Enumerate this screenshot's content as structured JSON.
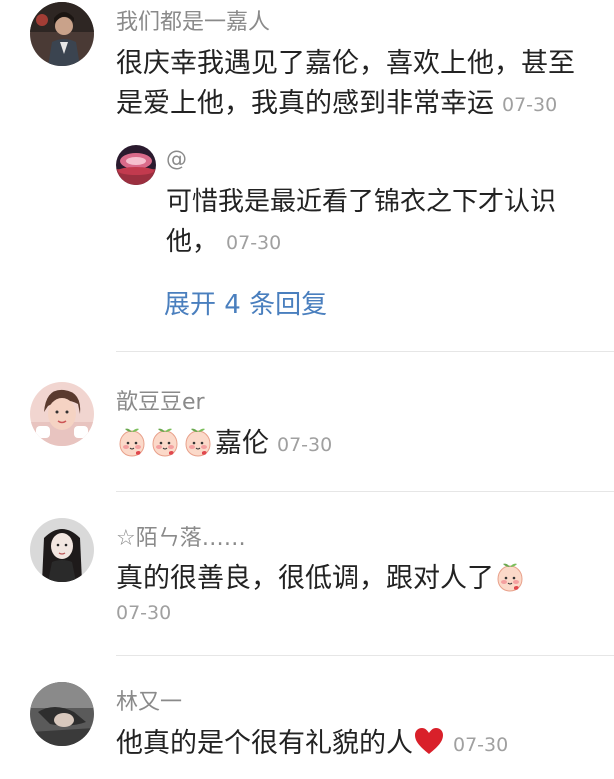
{
  "comments": [
    {
      "username": "我们都是一嘉人",
      "content": "很庆幸我遇见了嘉伦，喜欢上他，甚至是爱上他，我真的感到非常幸运",
      "time": "07-30",
      "reply": {
        "username": "@",
        "content": "可惜我是最近看了锦衣之下才认识他，",
        "time": "07-30"
      },
      "expand_label": "展开 4 条回复"
    },
    {
      "username": "歆豆豆er",
      "content": "嘉伦",
      "time": "07-30",
      "emoji": "peach-emoji"
    },
    {
      "username": "☆陌ㄣ落……",
      "content": "真的很善良，很低调，跟对人了",
      "time": "07-30",
      "emoji": "peach-emoji"
    },
    {
      "username": "林又一",
      "content": "他真的是个很有礼貌的人",
      "time": "07-30",
      "emoji": "red-heart"
    }
  ],
  "colors": {
    "link": "#4a7fbe",
    "meta": "#a0a0a0",
    "divider": "#e6e6e6"
  }
}
